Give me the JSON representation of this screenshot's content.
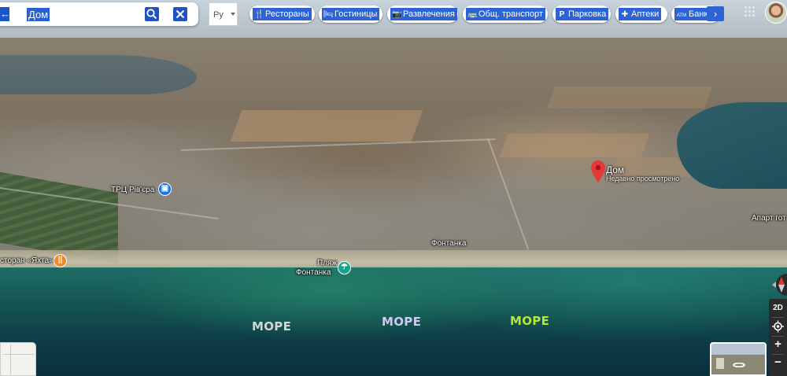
{
  "search": {
    "value": "Дом"
  },
  "language": {
    "selected": "Ру"
  },
  "chips": [
    {
      "icon": "fork-knife-icon",
      "glyph": "🍴",
      "label": "Рестораны"
    },
    {
      "icon": "bed-icon",
      "glyph": "🛏",
      "label": "Гостиницы"
    },
    {
      "icon": "camera-icon",
      "glyph": "📷",
      "label": "Развлечения"
    },
    {
      "icon": "bus-icon",
      "glyph": "🚌",
      "label": "Общ. транспорт"
    },
    {
      "icon": "parking-icon",
      "glyph": "P",
      "label": "Парковка"
    },
    {
      "icon": "pharmacy-icon",
      "glyph": "✚",
      "label": "Аптеки"
    },
    {
      "icon": "atm-icon",
      "glyph": "ATM",
      "label": "Банки"
    }
  ],
  "map": {
    "labels": {
      "mall": "ТРЦ Рів'єра",
      "restaurant": "сторан «Яхта»",
      "beach_line1": "Пляж",
      "beach_line2": "Фонтанка",
      "village": "Фонтанка",
      "apart": "Апарт гот"
    },
    "selected_place": {
      "title": "Дом",
      "subtitle": "Недавно просмотрено"
    },
    "sea_labels": [
      {
        "text": "МОРЕ",
        "color": "#d4d4d4"
      },
      {
        "text": "МОРЕ",
        "color": "#cfcaf0"
      },
      {
        "text": "МОРЕ",
        "color": "#b6e63a"
      }
    ],
    "colors": {
      "accent": "#2e63d6",
      "pin": "#e53935",
      "shopping": "#1a73e8",
      "food": "#f08a24",
      "beach": "#18a08a"
    }
  },
  "controls": {
    "mode_2d": "2D",
    "zoom_in": "+",
    "zoom_out": "−"
  }
}
